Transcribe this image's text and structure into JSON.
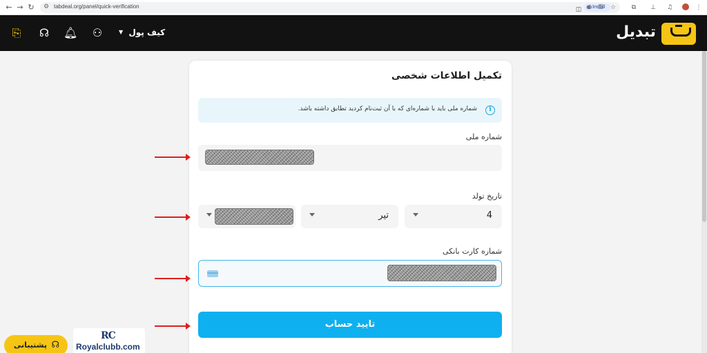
{
  "browser": {
    "url": "tabdeal.org/panel/quick-verification",
    "install_label": "Install"
  },
  "header": {
    "logo_text": "تبدیل",
    "wallet_label": "کیف پول"
  },
  "form": {
    "title": "تکمیل اطلاعات شخصی",
    "info": "شماره ملی باید با شماره‌ای که با آن ثبت‌نام کردید تطابق داشته باشد.",
    "national_id_label": "شماره ملی",
    "birth_date_label": "تاریخ تولد",
    "birth_day": "4",
    "birth_month": "تیر",
    "card_number_label": "شماره کارت بانکی",
    "submit_label": "تایید حساب"
  },
  "support": {
    "label": "پشتیبانی"
  },
  "watermark": {
    "logo": "RC",
    "text": "Royalclubb.com"
  },
  "colors": {
    "accent": "#0fb0ef",
    "brand_yellow": "#f6c514",
    "header_bg": "#121212",
    "arrow": "#e01e1e"
  }
}
